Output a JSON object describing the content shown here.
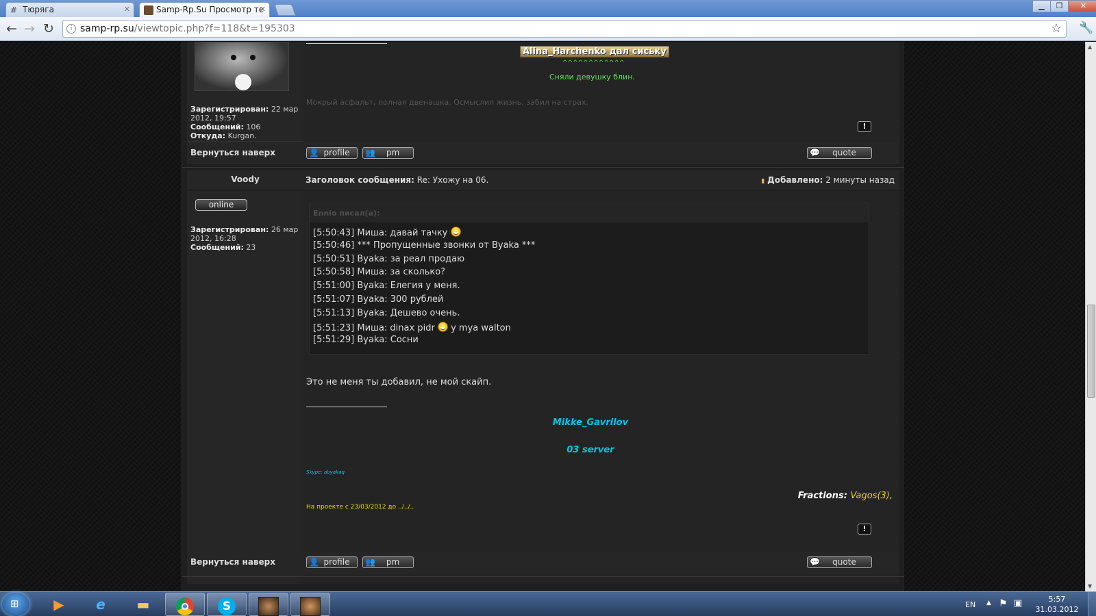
{
  "browser": {
    "tabs": [
      {
        "label": "Тюрягa",
        "icon": "hash-icon"
      },
      {
        "label": "Samp-Rp.Su Просмотр те",
        "icon": "site-favicon"
      }
    ],
    "url": {
      "host": "samp-rp.su",
      "path": "/viewtopic.php?f=118&t=195303"
    }
  },
  "post1": {
    "sig_title": "Alina_Harchenko дал сиську",
    "sig_carets": "^^^^^^^^^^^^",
    "sig_caption": "Сняли девушку блин.",
    "sig_text": "Мокрый асфальт, полная двенашка. Осмыслил жизнь, забил на страх.",
    "registered_label": "Зарегистрирован:",
    "registered_value": "22 мар 2012, 19:57",
    "posts_label": "Сообщений:",
    "posts_value": "106",
    "from_label": "Откуда:",
    "from_value": "Kurgan."
  },
  "post2": {
    "author": "Voody",
    "status": "online",
    "subject_label": "Заголовок сообщения:",
    "subject_value": "Re: Ухожу на 06.",
    "added_label": "Добавлено:",
    "added_value": "2 минуты назад",
    "registered_label": "Зарегистрирован:",
    "registered_value": "26 мар 2012, 16:28",
    "posts_label": "Сообщений:",
    "posts_value": "23",
    "quote_author": "Ennio писал(а):",
    "quote_lines": [
      {
        "text": "[5:50:43] Миша: давай тачку",
        "suffix": ""
      },
      {
        "text": "[5:50:46] *** Пропущенные звонки от Byaka ***",
        "suffix": ""
      },
      {
        "text": "[5:50:51] Byaka: за реал продаю",
        "suffix": ""
      },
      {
        "text": "[5:50:58] Миша: за сколько?",
        "suffix": ""
      },
      {
        "text": "[5:51:00] Byaka: Елегия у меня.",
        "suffix": ""
      },
      {
        "text": "[5:51:07] Byaka: 300 рублей",
        "suffix": ""
      },
      {
        "text": "[5:51:13] Byaka: Дешево очень.",
        "suffix": ""
      },
      {
        "text": "[5:51:23] Миша: dinax pidr",
        "suffix": "у mya walton"
      },
      {
        "text": "[5:51:29] Byaka: Сосни",
        "suffix": ""
      }
    ],
    "message": "Это не меня ты добавил, не мой скайп.",
    "sig_name": "Mikke_Gavrilov",
    "sig_server": "03 server",
    "sig_skype": "Skype: abyakaq",
    "fractions_label": "Fractions:",
    "fractions_value": "Vagos(3),",
    "project_text": "На проекте с 23/03/2012 до ../../.."
  },
  "buttons": {
    "back_to_top": "Вернуться наверх",
    "profile": "profile",
    "pm": "pm",
    "quote": "quote",
    "report": "!"
  },
  "taskbar": {
    "lang": "EN",
    "time": "5:57",
    "date": "31.03.2012"
  },
  "colors": {
    "accent_cyan": "#00c8e6",
    "accent_green": "#5fe35a",
    "accent_yellow": "#e8d21b",
    "quote_header": "#4e4e4e"
  }
}
